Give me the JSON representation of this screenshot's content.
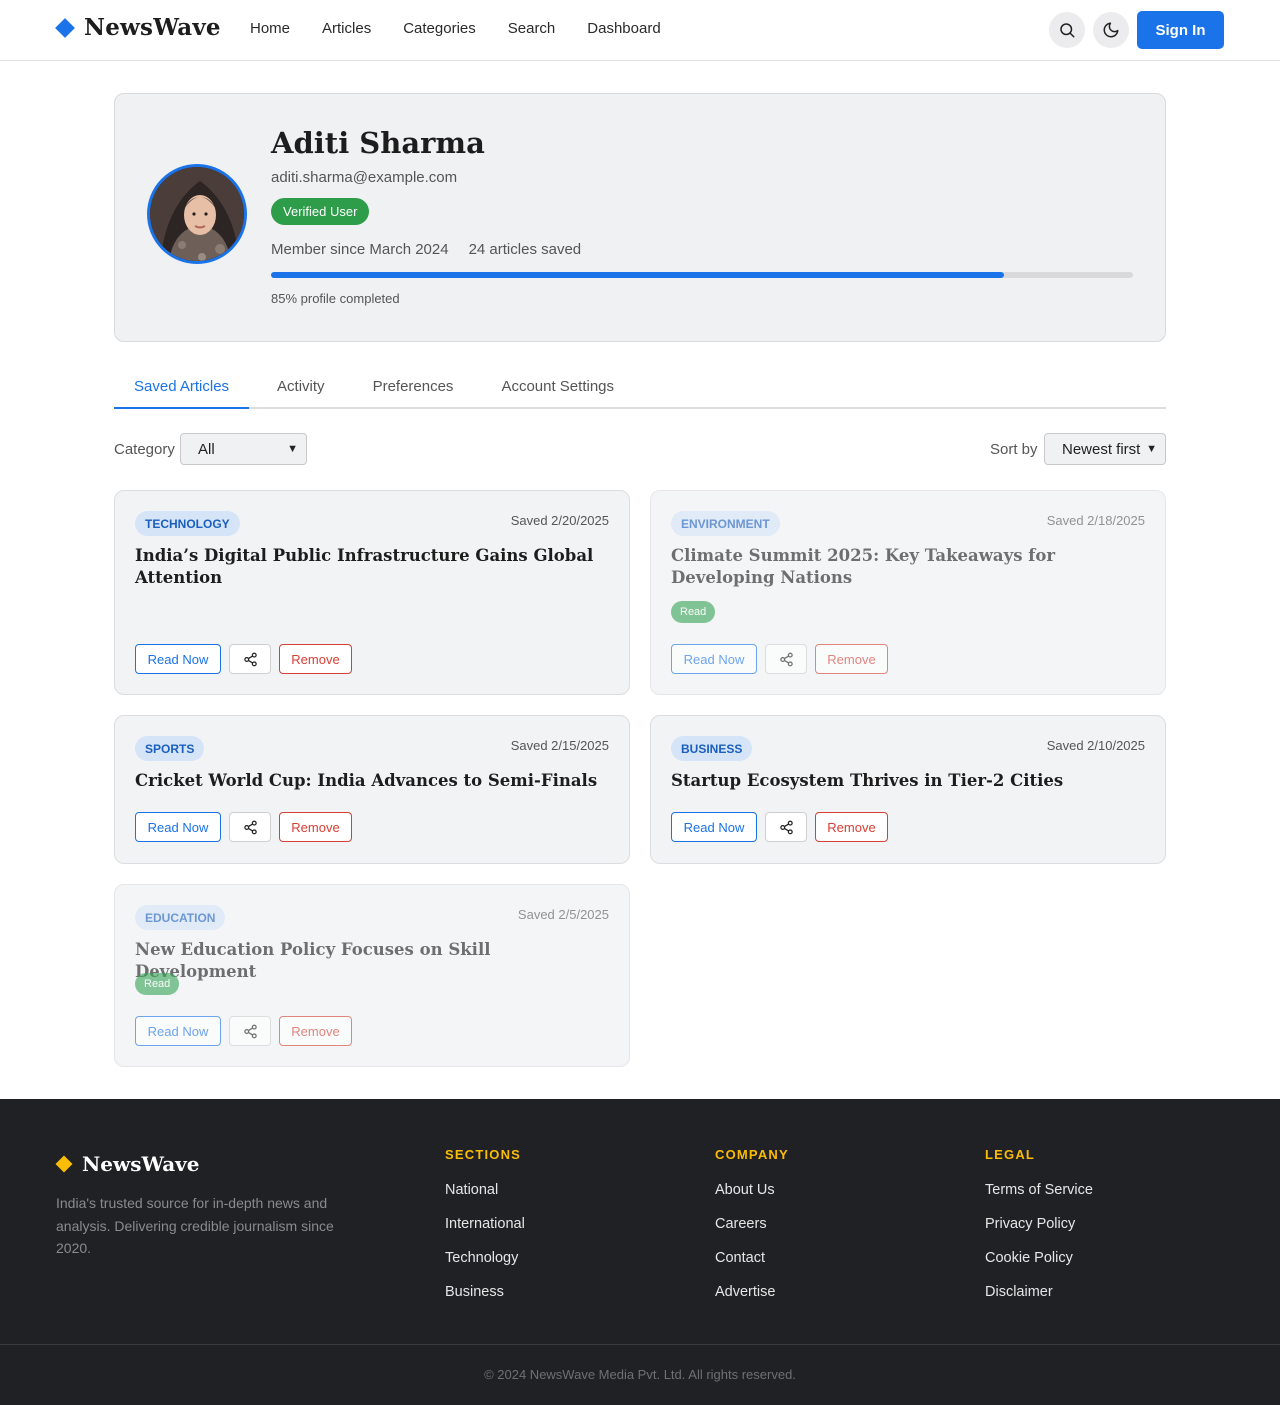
{
  "header": {
    "brand": "NewsWave",
    "nav": [
      "Home",
      "Articles",
      "Categories",
      "Search",
      "Dashboard"
    ],
    "signin_label": "Sign In",
    "icons": [
      "search-icon",
      "moon-icon"
    ]
  },
  "profile": {
    "name": "Aditi Sharma",
    "email": "aditi.sharma@example.com",
    "badge": "Verified User",
    "member_since": "Member since March 2024",
    "articles_saved": "24 articles saved",
    "completion_text": "85% profile completed",
    "completion": 0.85
  },
  "tabs": [
    "Saved Articles",
    "Activity",
    "Preferences",
    "Account Settings"
  ],
  "filters": {
    "category_label": "Category",
    "category_value": "All",
    "sort_label": "Sort by",
    "sort_value": "Newest first"
  },
  "articles": [
    {
      "category": "TECHNOLOGY",
      "saved": "Saved 2/20/2025",
      "title": "India’s Digital Public Infrastructure Gains Global Attention",
      "read_badge": "",
      "read_now": "Read Now",
      "remove": "Remove"
    },
    {
      "category": "ENVIRONMENT",
      "saved": "Saved 2/18/2025",
      "title": "Climate Summit 2025: Key Takeaways for Developing Nations",
      "read_badge": "Read",
      "read_now": "Read Now",
      "remove": "Remove"
    },
    {
      "category": "SPORTS",
      "saved": "Saved 2/15/2025",
      "title": "Cricket World Cup: India Advances to Semi-Finals",
      "read_badge": "",
      "read_now": "Read Now",
      "remove": "Remove"
    },
    {
      "category": "BUSINESS",
      "saved": "Saved 2/10/2025",
      "title": "Startup Ecosystem Thrives in Tier-2 Cities",
      "read_badge": "",
      "read_now": "Read Now",
      "remove": "Remove"
    },
    {
      "category": "EDUCATION",
      "saved": "Saved 2/5/2025",
      "title": "New Education Policy Focuses on Skill Development",
      "read_badge": "Read",
      "read_now": "Read Now",
      "remove": "Remove"
    }
  ],
  "footer": {
    "brand": "NewsWave",
    "description": "India's trusted source for in-depth news and analysis. Delivering credible journalism since 2020.",
    "columns": [
      {
        "title": "SECTIONS",
        "links": [
          "National",
          "International",
          "Technology",
          "Business"
        ]
      },
      {
        "title": "COMPANY",
        "links": [
          "About Us",
          "Careers",
          "Contact",
          "Advertise"
        ]
      },
      {
        "title": "LEGAL",
        "links": [
          "Terms of Service",
          "Privacy Policy",
          "Cookie Policy",
          "Disclaimer"
        ]
      }
    ],
    "copyright": "© 2024 NewsWave Media Pvt. Ltd. All rights reserved."
  },
  "colors": {
    "accent": "#1a73e8",
    "success": "#2e9d4a",
    "danger": "#d84035",
    "footer_bg": "#202124",
    "footer_heading": "#fbbc04"
  }
}
